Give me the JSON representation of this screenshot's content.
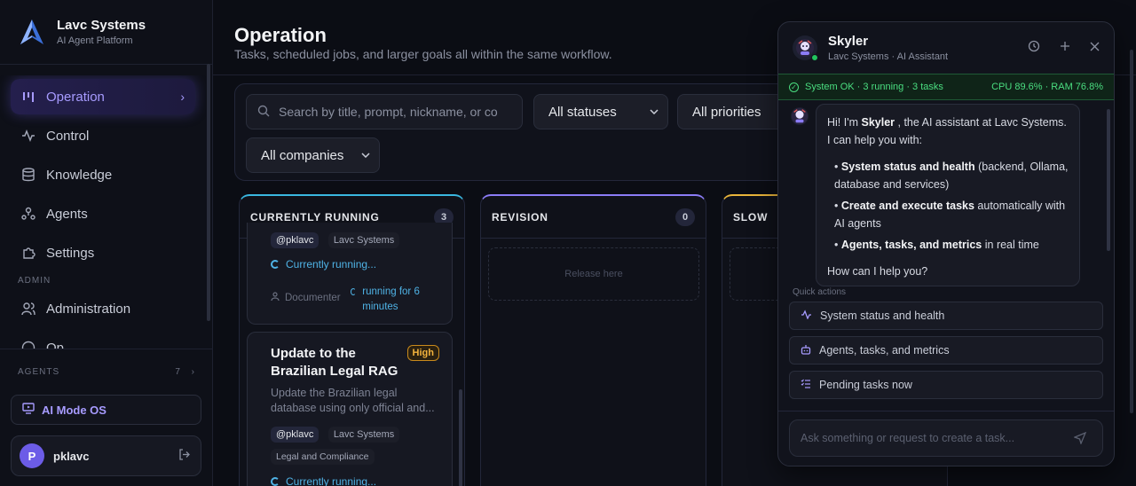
{
  "brand": {
    "title": "Lavc Systems",
    "subtitle": "AI Agent Platform"
  },
  "nav": {
    "items": [
      {
        "label": "Operation",
        "icon": "kanban-icon",
        "active": true
      },
      {
        "label": "Control",
        "icon": "activity-icon"
      },
      {
        "label": "Knowledge",
        "icon": "database-icon"
      },
      {
        "label": "Agents",
        "icon": "agents-icon"
      },
      {
        "label": "Settings",
        "icon": "puzzle-icon"
      },
      {
        "label": "Administration",
        "icon": "users-icon"
      },
      {
        "label": "Op",
        "icon": "info-icon"
      }
    ],
    "section_admin": "ADMIN"
  },
  "sidebar_bottom": {
    "agents_label": "AGENTS",
    "agents_count": "7",
    "ai_mode_label": "AI Mode OS",
    "user": {
      "initial": "P",
      "name": "pklavc"
    }
  },
  "page": {
    "title": "Operation",
    "subtitle": "Tasks, scheduled jobs, and larger goals all within the same workflow."
  },
  "filters": {
    "search_placeholder": "Search by title, prompt, nickname, or co",
    "status_select": "All statuses",
    "priority_select": "All priorities",
    "company_select": "All companies"
  },
  "columns": [
    {
      "title": "CURRENTLY RUNNING",
      "count": "3"
    },
    {
      "title": "REVISION",
      "count": "0",
      "empty_text": "Release here"
    },
    {
      "title": "SLOW"
    }
  ],
  "cards": [
    {
      "nickname": "@pklavc",
      "company": "Lavc Systems",
      "status": "Currently running...",
      "agent": "Documenter",
      "duration": "running for 6 minutes"
    },
    {
      "title": "Update to the Brazilian Legal RAG",
      "priority": "High",
      "description": "Update the Brazilian legal database using only official and...",
      "nickname": "@pklavc",
      "company": "Lavc Systems",
      "category": "Legal and Compliance",
      "status": "Currently running..."
    }
  ],
  "chat": {
    "name": "Skyler",
    "subtitle": "Lavc Systems · AI Assistant",
    "status_left": "System OK · 3 running · 3 tasks",
    "status_right": "CPU 89.6% · RAM 76.8%",
    "greeting_pre": "Hi! I'm ",
    "greeting_name": "Skyler",
    "greeting_post": " , the AI assistant at Lavc Systems. I can help you with:",
    "bullets": [
      {
        "bold": "System status and health",
        "rest": " (backend, Ollama, database and services)"
      },
      {
        "bold": "Create and execute tasks",
        "rest": " automatically with AI agents"
      },
      {
        "bold": "Agents, tasks, and metrics",
        "rest": " in real time"
      }
    ],
    "closing": "How can I help you?",
    "quick_label": "Quick actions",
    "quick_actions": [
      {
        "label": "System status and health",
        "icon": "pulse-icon"
      },
      {
        "label": "Agents, tasks, and metrics",
        "icon": "bot-icon"
      },
      {
        "label": "Pending tasks now",
        "icon": "list-check-icon"
      }
    ],
    "input_placeholder": "Ask something or request to create a task..."
  },
  "colors": {
    "accent": "#6c5ce7",
    "running": "#4fb3e6",
    "ok": "#4ade80",
    "high": "#f2b23d"
  }
}
